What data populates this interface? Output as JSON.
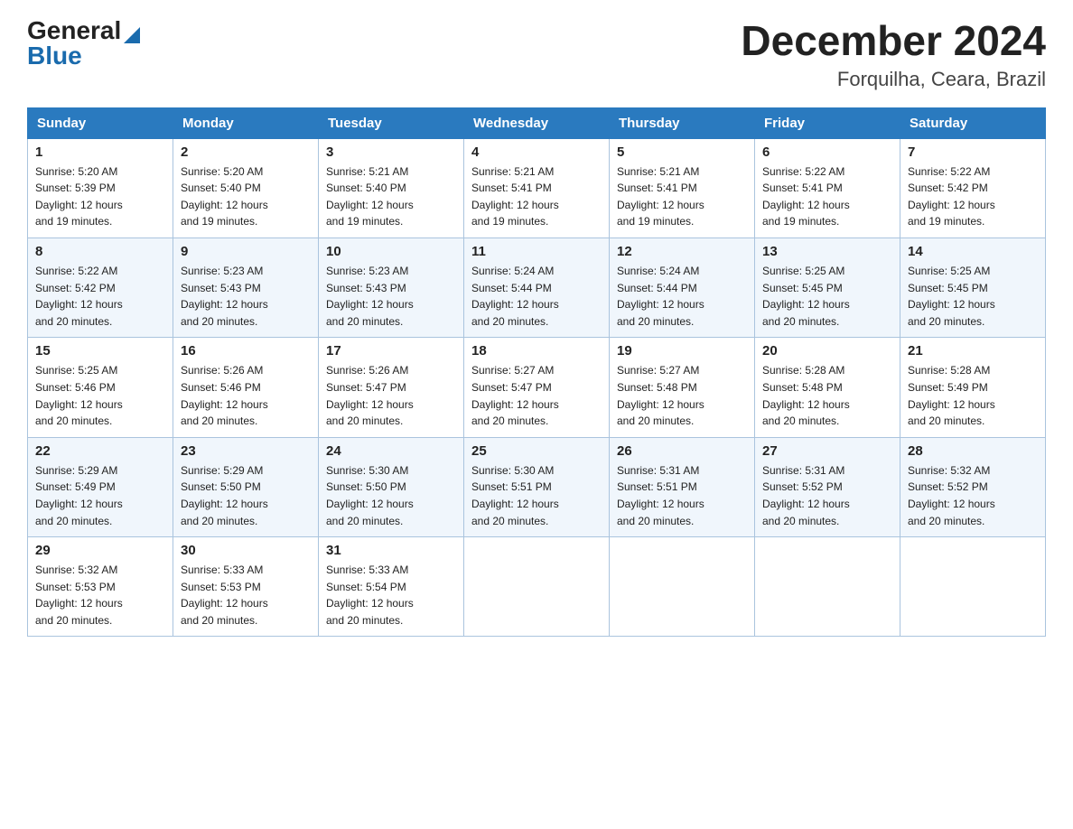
{
  "header": {
    "logo_general": "General",
    "logo_blue": "Blue",
    "title": "December 2024",
    "subtitle": "Forquilha, Ceara, Brazil"
  },
  "columns": [
    "Sunday",
    "Monday",
    "Tuesday",
    "Wednesday",
    "Thursday",
    "Friday",
    "Saturday"
  ],
  "weeks": [
    [
      {
        "day": "1",
        "info": "Sunrise: 5:20 AM\nSunset: 5:39 PM\nDaylight: 12 hours\nand 19 minutes."
      },
      {
        "day": "2",
        "info": "Sunrise: 5:20 AM\nSunset: 5:40 PM\nDaylight: 12 hours\nand 19 minutes."
      },
      {
        "day": "3",
        "info": "Sunrise: 5:21 AM\nSunset: 5:40 PM\nDaylight: 12 hours\nand 19 minutes."
      },
      {
        "day": "4",
        "info": "Sunrise: 5:21 AM\nSunset: 5:41 PM\nDaylight: 12 hours\nand 19 minutes."
      },
      {
        "day": "5",
        "info": "Sunrise: 5:21 AM\nSunset: 5:41 PM\nDaylight: 12 hours\nand 19 minutes."
      },
      {
        "day": "6",
        "info": "Sunrise: 5:22 AM\nSunset: 5:41 PM\nDaylight: 12 hours\nand 19 minutes."
      },
      {
        "day": "7",
        "info": "Sunrise: 5:22 AM\nSunset: 5:42 PM\nDaylight: 12 hours\nand 19 minutes."
      }
    ],
    [
      {
        "day": "8",
        "info": "Sunrise: 5:22 AM\nSunset: 5:42 PM\nDaylight: 12 hours\nand 20 minutes."
      },
      {
        "day": "9",
        "info": "Sunrise: 5:23 AM\nSunset: 5:43 PM\nDaylight: 12 hours\nand 20 minutes."
      },
      {
        "day": "10",
        "info": "Sunrise: 5:23 AM\nSunset: 5:43 PM\nDaylight: 12 hours\nand 20 minutes."
      },
      {
        "day": "11",
        "info": "Sunrise: 5:24 AM\nSunset: 5:44 PM\nDaylight: 12 hours\nand 20 minutes."
      },
      {
        "day": "12",
        "info": "Sunrise: 5:24 AM\nSunset: 5:44 PM\nDaylight: 12 hours\nand 20 minutes."
      },
      {
        "day": "13",
        "info": "Sunrise: 5:25 AM\nSunset: 5:45 PM\nDaylight: 12 hours\nand 20 minutes."
      },
      {
        "day": "14",
        "info": "Sunrise: 5:25 AM\nSunset: 5:45 PM\nDaylight: 12 hours\nand 20 minutes."
      }
    ],
    [
      {
        "day": "15",
        "info": "Sunrise: 5:25 AM\nSunset: 5:46 PM\nDaylight: 12 hours\nand 20 minutes."
      },
      {
        "day": "16",
        "info": "Sunrise: 5:26 AM\nSunset: 5:46 PM\nDaylight: 12 hours\nand 20 minutes."
      },
      {
        "day": "17",
        "info": "Sunrise: 5:26 AM\nSunset: 5:47 PM\nDaylight: 12 hours\nand 20 minutes."
      },
      {
        "day": "18",
        "info": "Sunrise: 5:27 AM\nSunset: 5:47 PM\nDaylight: 12 hours\nand 20 minutes."
      },
      {
        "day": "19",
        "info": "Sunrise: 5:27 AM\nSunset: 5:48 PM\nDaylight: 12 hours\nand 20 minutes."
      },
      {
        "day": "20",
        "info": "Sunrise: 5:28 AM\nSunset: 5:48 PM\nDaylight: 12 hours\nand 20 minutes."
      },
      {
        "day": "21",
        "info": "Sunrise: 5:28 AM\nSunset: 5:49 PM\nDaylight: 12 hours\nand 20 minutes."
      }
    ],
    [
      {
        "day": "22",
        "info": "Sunrise: 5:29 AM\nSunset: 5:49 PM\nDaylight: 12 hours\nand 20 minutes."
      },
      {
        "day": "23",
        "info": "Sunrise: 5:29 AM\nSunset: 5:50 PM\nDaylight: 12 hours\nand 20 minutes."
      },
      {
        "day": "24",
        "info": "Sunrise: 5:30 AM\nSunset: 5:50 PM\nDaylight: 12 hours\nand 20 minutes."
      },
      {
        "day": "25",
        "info": "Sunrise: 5:30 AM\nSunset: 5:51 PM\nDaylight: 12 hours\nand 20 minutes."
      },
      {
        "day": "26",
        "info": "Sunrise: 5:31 AM\nSunset: 5:51 PM\nDaylight: 12 hours\nand 20 minutes."
      },
      {
        "day": "27",
        "info": "Sunrise: 5:31 AM\nSunset: 5:52 PM\nDaylight: 12 hours\nand 20 minutes."
      },
      {
        "day": "28",
        "info": "Sunrise: 5:32 AM\nSunset: 5:52 PM\nDaylight: 12 hours\nand 20 minutes."
      }
    ],
    [
      {
        "day": "29",
        "info": "Sunrise: 5:32 AM\nSunset: 5:53 PM\nDaylight: 12 hours\nand 20 minutes."
      },
      {
        "day": "30",
        "info": "Sunrise: 5:33 AM\nSunset: 5:53 PM\nDaylight: 12 hours\nand 20 minutes."
      },
      {
        "day": "31",
        "info": "Sunrise: 5:33 AM\nSunset: 5:54 PM\nDaylight: 12 hours\nand 20 minutes."
      },
      null,
      null,
      null,
      null
    ]
  ]
}
